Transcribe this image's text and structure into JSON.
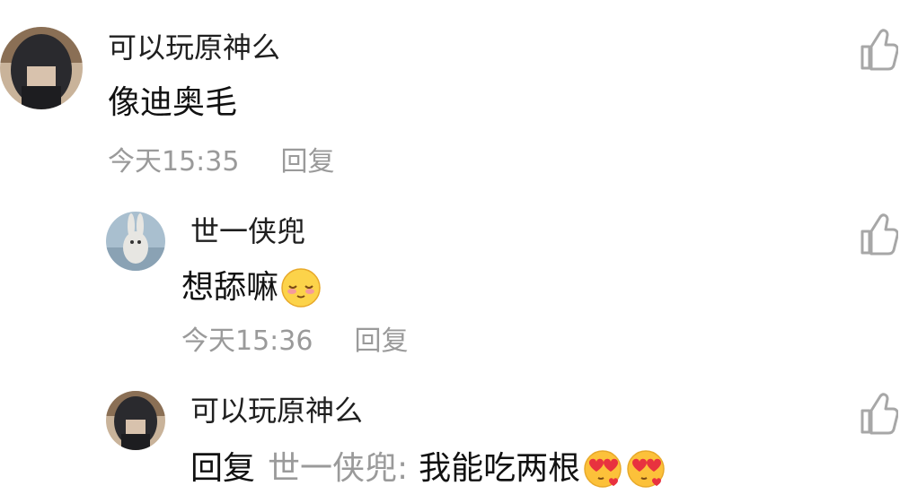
{
  "comments": [
    {
      "username": "可以玩原神么",
      "text": "像迪奥毛",
      "time": "今天15:35",
      "reply_label": "回复",
      "avatar": "dark-hair-girl-avatar"
    },
    {
      "username": "世一侠兜",
      "text": "想舔嘛",
      "emoji": "shy-smile-emoji",
      "time": "今天15:36",
      "reply_label": "回复",
      "avatar": "white-rabbit-avatar"
    },
    {
      "username": "可以玩原神么",
      "reply_prefix": "回复",
      "mention": "世一侠兜:",
      "text": "我能吃两根",
      "emoji": "heart-eyes-kiss-emoji",
      "avatar": "dark-hair-girl-avatar"
    }
  ],
  "icons": {
    "like": "thumbs-up-icon"
  }
}
